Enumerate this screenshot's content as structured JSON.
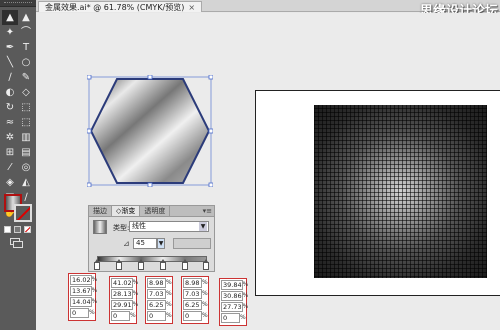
{
  "window": {
    "doc_tab_title": "金属效果.ai* @ 61.78% (CMYK/预览)",
    "doc_tab_close": "×",
    "watermark": "思缘设计论坛"
  },
  "toolbar": {
    "tools": [
      {
        "name": "selection-tool-icon",
        "glyph": "▲",
        "selected": true
      },
      {
        "name": "direct-selection-tool-icon",
        "glyph": "▲",
        "selected": false
      },
      {
        "name": "magic-wand-tool-icon",
        "glyph": "✦",
        "selected": false
      },
      {
        "name": "lasso-tool-icon",
        "glyph": "⌒",
        "selected": false
      },
      {
        "name": "pen-tool-icon",
        "glyph": "✒",
        "selected": false
      },
      {
        "name": "type-tool-icon",
        "glyph": "T",
        "selected": false
      },
      {
        "name": "line-tool-icon",
        "glyph": "╲",
        "selected": false
      },
      {
        "name": "ellipse-tool-icon",
        "glyph": "○",
        "selected": false
      },
      {
        "name": "paintbrush-tool-icon",
        "glyph": "∕",
        "selected": false
      },
      {
        "name": "pencil-tool-icon",
        "glyph": "✎",
        "selected": false
      },
      {
        "name": "blob-brush-tool-icon",
        "glyph": "◐",
        "selected": false
      },
      {
        "name": "eraser-tool-icon",
        "glyph": "◇",
        "selected": false
      },
      {
        "name": "rotate-tool-icon",
        "glyph": "↻",
        "selected": false
      },
      {
        "name": "scale-tool-icon",
        "glyph": "⬚",
        "selected": false
      },
      {
        "name": "warp-tool-icon",
        "glyph": "≈",
        "selected": false
      },
      {
        "name": "free-transform-tool-icon",
        "glyph": "⬚",
        "selected": false
      },
      {
        "name": "symbol-sprayer-tool-icon",
        "glyph": "✲",
        "selected": false
      },
      {
        "name": "column-graph-tool-icon",
        "glyph": "▥",
        "selected": false
      },
      {
        "name": "mesh-tool-icon",
        "glyph": "⊞",
        "selected": false
      },
      {
        "name": "gradient-tool-icon",
        "glyph": "▤",
        "selected": false
      },
      {
        "name": "eyedropper-tool-icon",
        "glyph": "⁄",
        "selected": false
      },
      {
        "name": "blend-tool-icon",
        "glyph": "◎",
        "selected": false
      },
      {
        "name": "live-paint-bucket-icon",
        "glyph": "◈",
        "selected": false
      },
      {
        "name": "live-paint-selection-icon",
        "glyph": "◭",
        "selected": false
      },
      {
        "name": "artboard-tool-icon",
        "glyph": "□",
        "selected": false
      },
      {
        "name": "slice-tool-icon",
        "glyph": "∕",
        "selected": false
      },
      {
        "name": "hand-tool-icon",
        "glyph": "✋",
        "selected": false
      },
      {
        "name": "zoom-tool-icon",
        "glyph": "⚲",
        "selected": false
      }
    ]
  },
  "gradient_panel": {
    "tabs": [
      "描边",
      "◇渐变",
      "透明度"
    ],
    "menu_icon": "▾≡",
    "type_label": "类型:",
    "type_value": "线性",
    "angle_icon": "⊿",
    "angle_value": "45",
    "angle_dropdown": "▼",
    "type_dropdown": "▼",
    "ramp_colors": [
      "#333333",
      "#eeeeee",
      "#666666",
      "#eeeeee",
      "#777777",
      "#999999"
    ]
  },
  "cmyk_boxes": [
    {
      "values": [
        "16.02",
        "13.67",
        "14.04",
        "0"
      ],
      "unit": "%"
    },
    {
      "values": [
        "41.02",
        "28.13",
        "29.91",
        "0"
      ],
      "unit": "%"
    },
    {
      "values": [
        "8.98",
        "7.03",
        "6.25",
        "0"
      ],
      "unit": "%"
    },
    {
      "values": [
        "8.98",
        "7.03",
        "6.25",
        "0"
      ],
      "unit": "%"
    },
    {
      "values": [
        "39.84",
        "30.86",
        "27.73",
        "0"
      ],
      "unit": "%"
    }
  ]
}
